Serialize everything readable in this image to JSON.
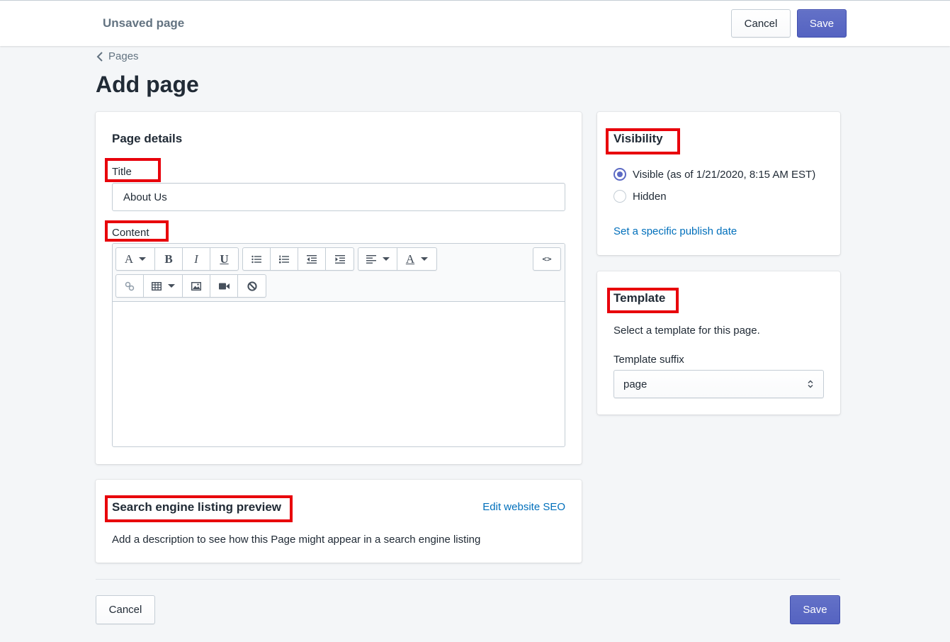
{
  "topbar": {
    "title": "Unsaved page",
    "cancel_label": "Cancel",
    "save_label": "Save"
  },
  "breadcrumb": {
    "label": "Pages"
  },
  "page_title": "Add page",
  "page_details": {
    "heading": "Page details",
    "title_label": "Title",
    "title_value": "About Us",
    "content_label": "Content",
    "toolbar": {
      "row1": [
        "font-format-icon",
        "bold-icon",
        "italic-icon",
        "underline-icon",
        "bullet-list-icon",
        "numbered-list-icon",
        "outdent-icon",
        "indent-icon",
        "align-left-icon",
        "text-color-icon",
        "html-source-icon"
      ],
      "row2": [
        "link-icon",
        "table-icon",
        "image-icon",
        "video-icon",
        "clear-formatting-icon"
      ],
      "glyphs": {
        "font": "A",
        "bold": "B",
        "italic": "I",
        "underline": "U",
        "color": "A",
        "source": "<>"
      }
    },
    "content_value": ""
  },
  "seo": {
    "heading": "Search engine listing preview",
    "edit_link": "Edit website SEO",
    "description": "Add a description to see how this Page might appear in a search engine listing"
  },
  "visibility": {
    "heading": "Visibility",
    "options": [
      {
        "label": "Visible (as of 1/21/2020, 8:15 AM EST)",
        "checked": true
      },
      {
        "label": "Hidden",
        "checked": false
      }
    ],
    "publish_link": "Set a specific publish date"
  },
  "template": {
    "heading": "Template",
    "description": "Select a template for this page.",
    "suffix_label": "Template suffix",
    "suffix_value": "page"
  },
  "footer": {
    "cancel_label": "Cancel",
    "save_label": "Save"
  },
  "colors": {
    "primary": "#5c6ac4",
    "link": "#006fbb",
    "highlight": "#e8000b",
    "background": "#f4f6f8"
  }
}
